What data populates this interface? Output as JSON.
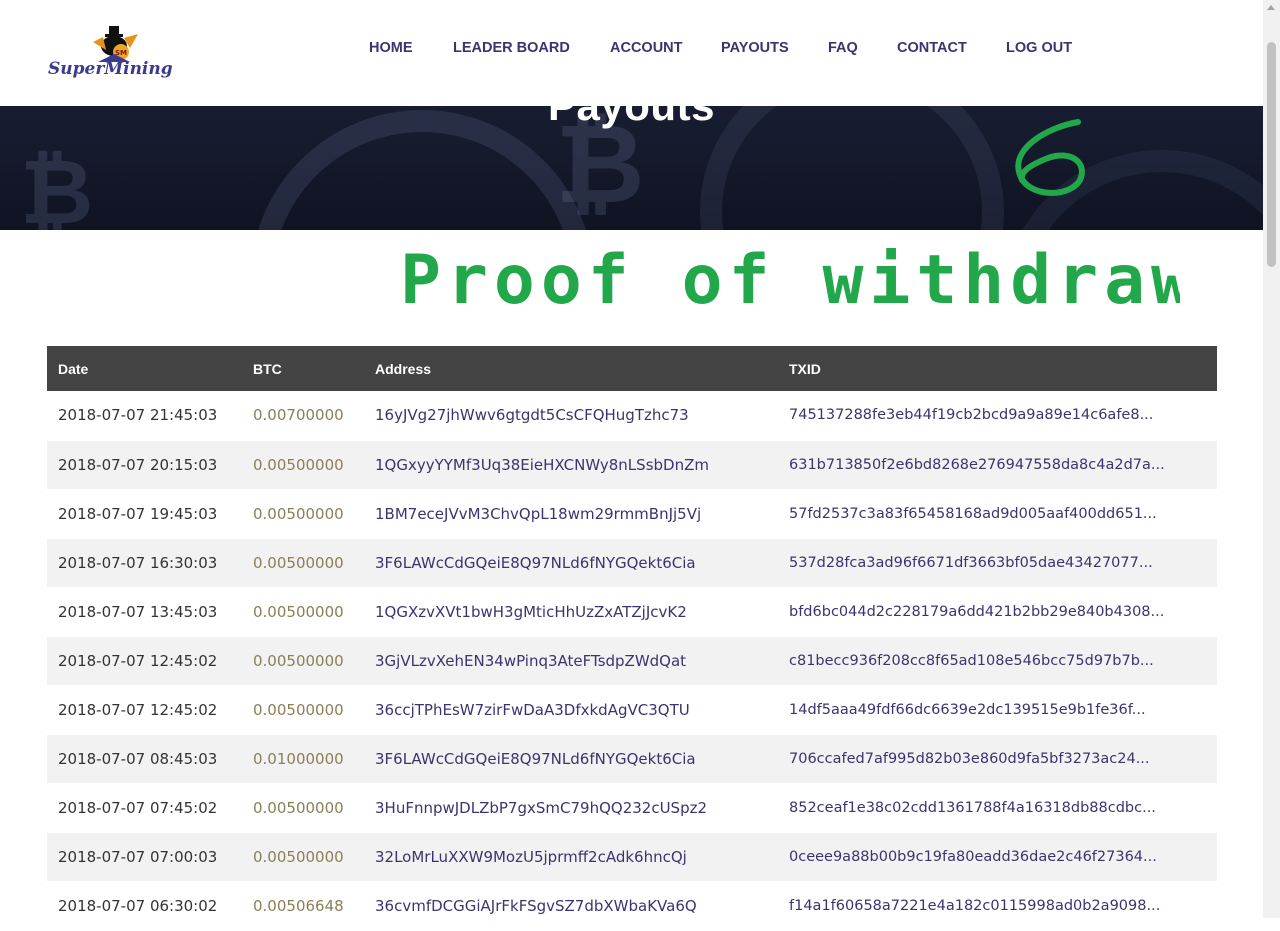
{
  "header": {
    "logo_text": "SuperMining",
    "logo_badge": "SM",
    "nav": [
      {
        "label": "HOME"
      },
      {
        "label": "LEADER BOARD"
      },
      {
        "label": "ACCOUNT"
      },
      {
        "label": "PAYOUTS"
      },
      {
        "label": "FAQ"
      },
      {
        "label": "CONTACT"
      },
      {
        "label": "LOG OUT"
      }
    ]
  },
  "hero": {
    "title": "Payouts"
  },
  "annotation": {
    "number": "6",
    "text": "Proof of withdrawl",
    "color": "#22a84a"
  },
  "table": {
    "columns": [
      "Date",
      "BTC",
      "Address",
      "TXID"
    ],
    "rows": [
      {
        "date": "2018-07-07 21:45:03",
        "btc": "0.00700000",
        "address": "16yJVg27jhWwv6gtgdt5CsCFQHugTzhc73",
        "txid": "745137288fe3eb44f19cb2bcd9a9a89e14c6afe8..."
      },
      {
        "date": "2018-07-07 20:15:03",
        "btc": "0.00500000",
        "address": "1QGxyyYYMf3Uq38EieHXCNWy8nLSsbDnZm",
        "txid": "631b713850f2e6bd8268e276947558da8c4a2d7a..."
      },
      {
        "date": "2018-07-07 19:45:03",
        "btc": "0.00500000",
        "address": "1BM7eceJVvM3ChvQpL18wm29rmmBnJj5Vj",
        "txid": "57fd2537c3a83f65458168ad9d005aaf400dd651..."
      },
      {
        "date": "2018-07-07 16:30:03",
        "btc": "0.00500000",
        "address": "3F6LAWcCdGQeiE8Q97NLd6fNYGQekt6Cia",
        "txid": "537d28fca3ad96f6671df3663bf05dae43427077..."
      },
      {
        "date": "2018-07-07 13:45:03",
        "btc": "0.00500000",
        "address": "1QGXzvXVt1bwH3gMticHhUzZxATZjJcvK2",
        "txid": "bfd6bc044d2c228179a6dd421b2bb29e840b4308..."
      },
      {
        "date": "2018-07-07 12:45:02",
        "btc": "0.00500000",
        "address": "3GjVLzvXehEN34wPinq3AteFTsdpZWdQat",
        "txid": "c81becc936f208cc8f65ad108e546bcc75d97b7b..."
      },
      {
        "date": "2018-07-07 12:45:02",
        "btc": "0.00500000",
        "address": "36ccjTPhEsW7zirFwDaA3DfxkdAgVC3QTU",
        "txid": "14df5aaa49fdf66dc6639e2dc139515e9b1fe36f..."
      },
      {
        "date": "2018-07-07 08:45:03",
        "btc": "0.01000000",
        "address": "3F6LAWcCdGQeiE8Q97NLd6fNYGQekt6Cia",
        "txid": "706ccafed7af995d82b03e860d9fa5bf3273ac24..."
      },
      {
        "date": "2018-07-07 07:45:02",
        "btc": "0.00500000",
        "address": "3HuFnnpwJDLZbP7gxSmC79hQQ232cUSpz2",
        "txid": "852ceaf1e38c02cdd1361788f4a16318db88cdbc..."
      },
      {
        "date": "2018-07-07 07:00:03",
        "btc": "0.00500000",
        "address": "32LoMrLuXXW9MozU5jprmff2cAdk6hncQj",
        "txid": "0ceee9a88b00b9c19fa80eadd36dae2c46f27364..."
      },
      {
        "date": "2018-07-07 06:30:02",
        "btc": "0.00506648",
        "address": "36cvmfDCGGiAJrFkFSgvSZ7dbXWbaKVa6Q",
        "txid": "f14a1f60658a7221e4a182c0115998ad0b2a9098..."
      }
    ]
  },
  "colors": {
    "nav_text": "#3b3470",
    "header_row_bg": "#444444",
    "btc_text": "#8b7f57",
    "link_text": "#3b3470"
  }
}
